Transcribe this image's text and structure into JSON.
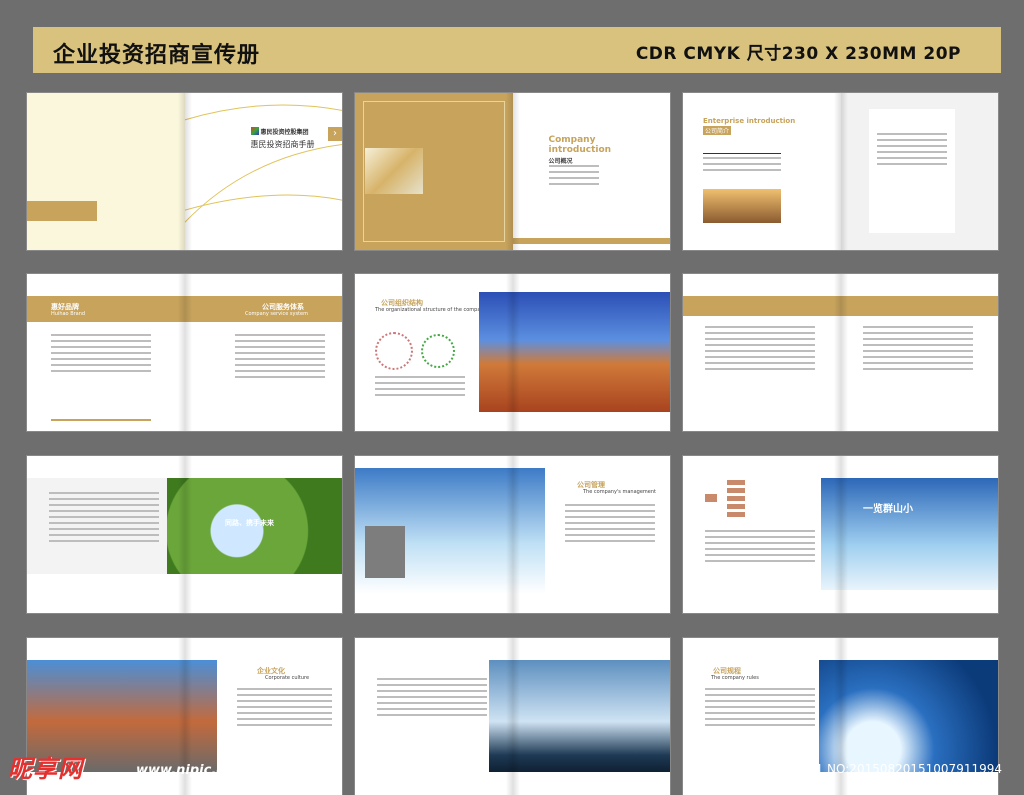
{
  "banner": {
    "title": "企业投资招商宣传册",
    "spec": "CDR  CMYK  尺寸230 X 230MM  20P"
  },
  "spreads": {
    "s1": {
      "brand": "惠民投资控股集团",
      "subtitle": "惠民投资招商手册"
    },
    "s2": {
      "heading1": "Company",
      "heading2": "introduction",
      "subheading": "公司概况"
    },
    "s3": {
      "heading": "Enterprise introduction",
      "subheading": "公司简介"
    },
    "s4": {
      "left_title": "惠好品牌",
      "left_sub": "Huihao Brand",
      "right_title": "公司服务体系",
      "right_sub": "Company service system"
    },
    "s5": {
      "title": "公司组织结构",
      "sub": "The organizational structure of the company"
    },
    "s7": {
      "slogan": "同路、携手未来"
    },
    "s8": {
      "title": "公司管理",
      "sub": "The company's management"
    },
    "s9": {
      "slogan": "一览群山小"
    },
    "s10": {
      "title": "企业文化",
      "sub": "Corporate culture"
    },
    "s12": {
      "title": "公司规程",
      "sub": "The company rules"
    }
  },
  "watermark": {
    "logo": "昵享网",
    "url": "www.nipic.cn",
    "id": "ID:5809661 NO:20150820151007911994"
  }
}
